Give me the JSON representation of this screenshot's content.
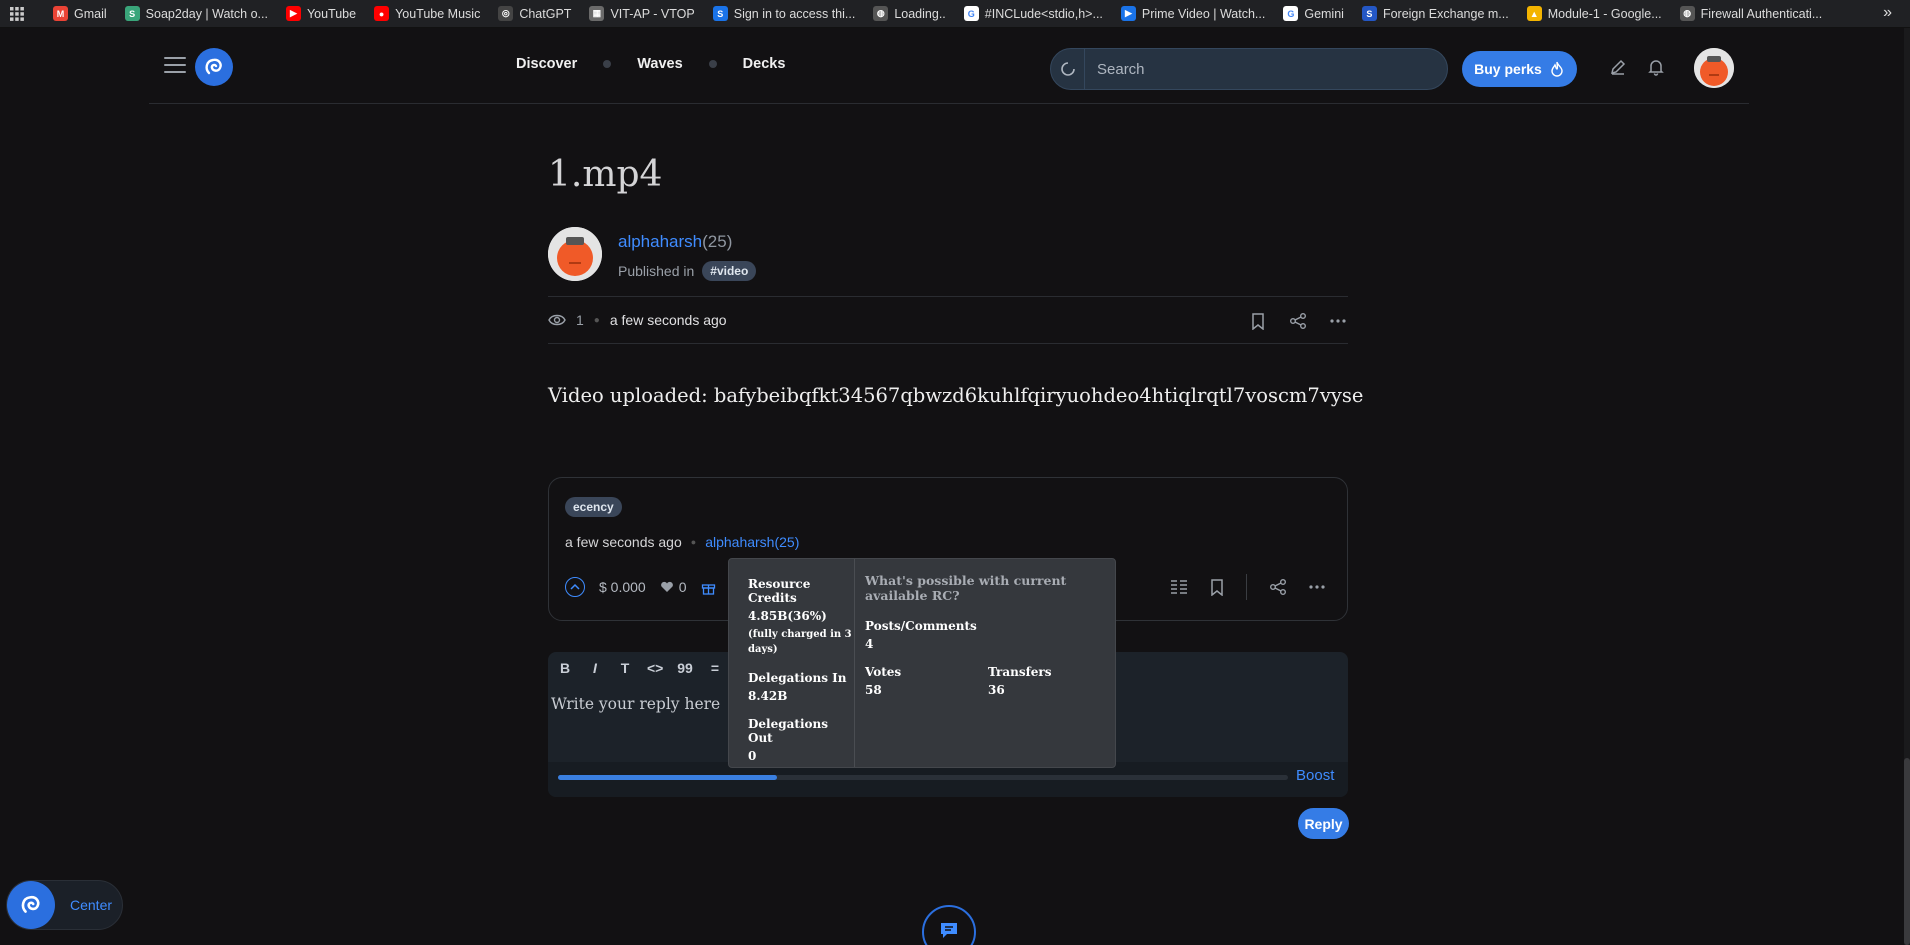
{
  "bookmarks": [
    {
      "label": "Gmail",
      "icon": "gmail-icon",
      "color": "#ea4335",
      "glyph": "M"
    },
    {
      "label": "Soap2day | Watch o...",
      "icon": "soap2day-icon",
      "color": "#3aa57a",
      "glyph": "S"
    },
    {
      "label": "YouTube",
      "icon": "youtube-icon",
      "color": "#ff0000",
      "glyph": "▶"
    },
    {
      "label": "YouTube Music",
      "icon": "youtube-music-icon",
      "color": "#ff0000",
      "glyph": "●"
    },
    {
      "label": "ChatGPT",
      "icon": "chatgpt-icon",
      "color": "#444",
      "glyph": "◎"
    },
    {
      "label": "VIT-AP - VTOP",
      "icon": "vtop-icon",
      "color": "#6a6a6a",
      "glyph": "▦"
    },
    {
      "label": "Sign in to access thi...",
      "icon": "sign-in-icon",
      "color": "#1a73e8",
      "glyph": "S"
    },
    {
      "label": "Loading..",
      "icon": "globe-icon",
      "color": "#555",
      "glyph": "◍"
    },
    {
      "label": "#INCLude<stdio,h>...",
      "icon": "google-icon",
      "color": "#ffffff",
      "glyph": "G"
    },
    {
      "label": "Prime Video | Watch...",
      "icon": "prime-video-icon",
      "color": "#1a73e8",
      "glyph": "▶"
    },
    {
      "label": "Gemini",
      "icon": "google-icon",
      "color": "#ffffff",
      "glyph": "G"
    },
    {
      "label": "Foreign Exchange m...",
      "icon": "forex-icon",
      "color": "#2457c5",
      "glyph": "S"
    },
    {
      "label": "Module-1 - Google...",
      "icon": "google-drive-icon",
      "color": "#f4b400",
      "glyph": "▲"
    },
    {
      "label": "Firewall Authenticati...",
      "icon": "globe-icon",
      "color": "#555",
      "glyph": "◍"
    }
  ],
  "header": {
    "nav": [
      "Discover",
      "Waves",
      "Decks"
    ],
    "search_placeholder": "Search",
    "buy_perks": "Buy perks"
  },
  "post": {
    "title": "1.mp4",
    "author": "alphaharsh",
    "reputation": "(25)",
    "published_in": "Published in",
    "community_tag": "#video",
    "views": "1",
    "time": "a few seconds ago",
    "body": "Video uploaded: bafybeibqfkt34567qbwzd6kuhlfqiryuohdeo4htiqlrqtl7voscm7vyse"
  },
  "card": {
    "tag": "ecency",
    "time": "a few seconds ago",
    "author": "alphaharsh(25)",
    "payout": "$ 0.000",
    "votes": "0"
  },
  "editor": {
    "toolbar": [
      "B",
      "I",
      "T",
      "<>",
      "99",
      "="
    ],
    "placeholder": "Write your reply here",
    "boost": "Boost",
    "progress_fraction": 0.3,
    "reply": "Reply"
  },
  "tooltip": {
    "rc_label": "Resource Credits",
    "rc_value": "4.85B(36%)",
    "rc_note": "(fully charged in 3 days)",
    "deleg_in_label": "Delegations In",
    "deleg_in_value": "8.42B",
    "deleg_out_label": "Delegations Out",
    "deleg_out_value": "0",
    "question": "What's possible with current available RC?",
    "posts_label": "Posts/Comments",
    "posts_value": "4",
    "votes_label": "Votes",
    "votes_value": "58",
    "transfers_label": "Transfers",
    "transfers_value": "36"
  },
  "center_label": "Center",
  "colors": {
    "accent": "#357ce6",
    "link": "#3f8cff",
    "background": "#121113"
  }
}
